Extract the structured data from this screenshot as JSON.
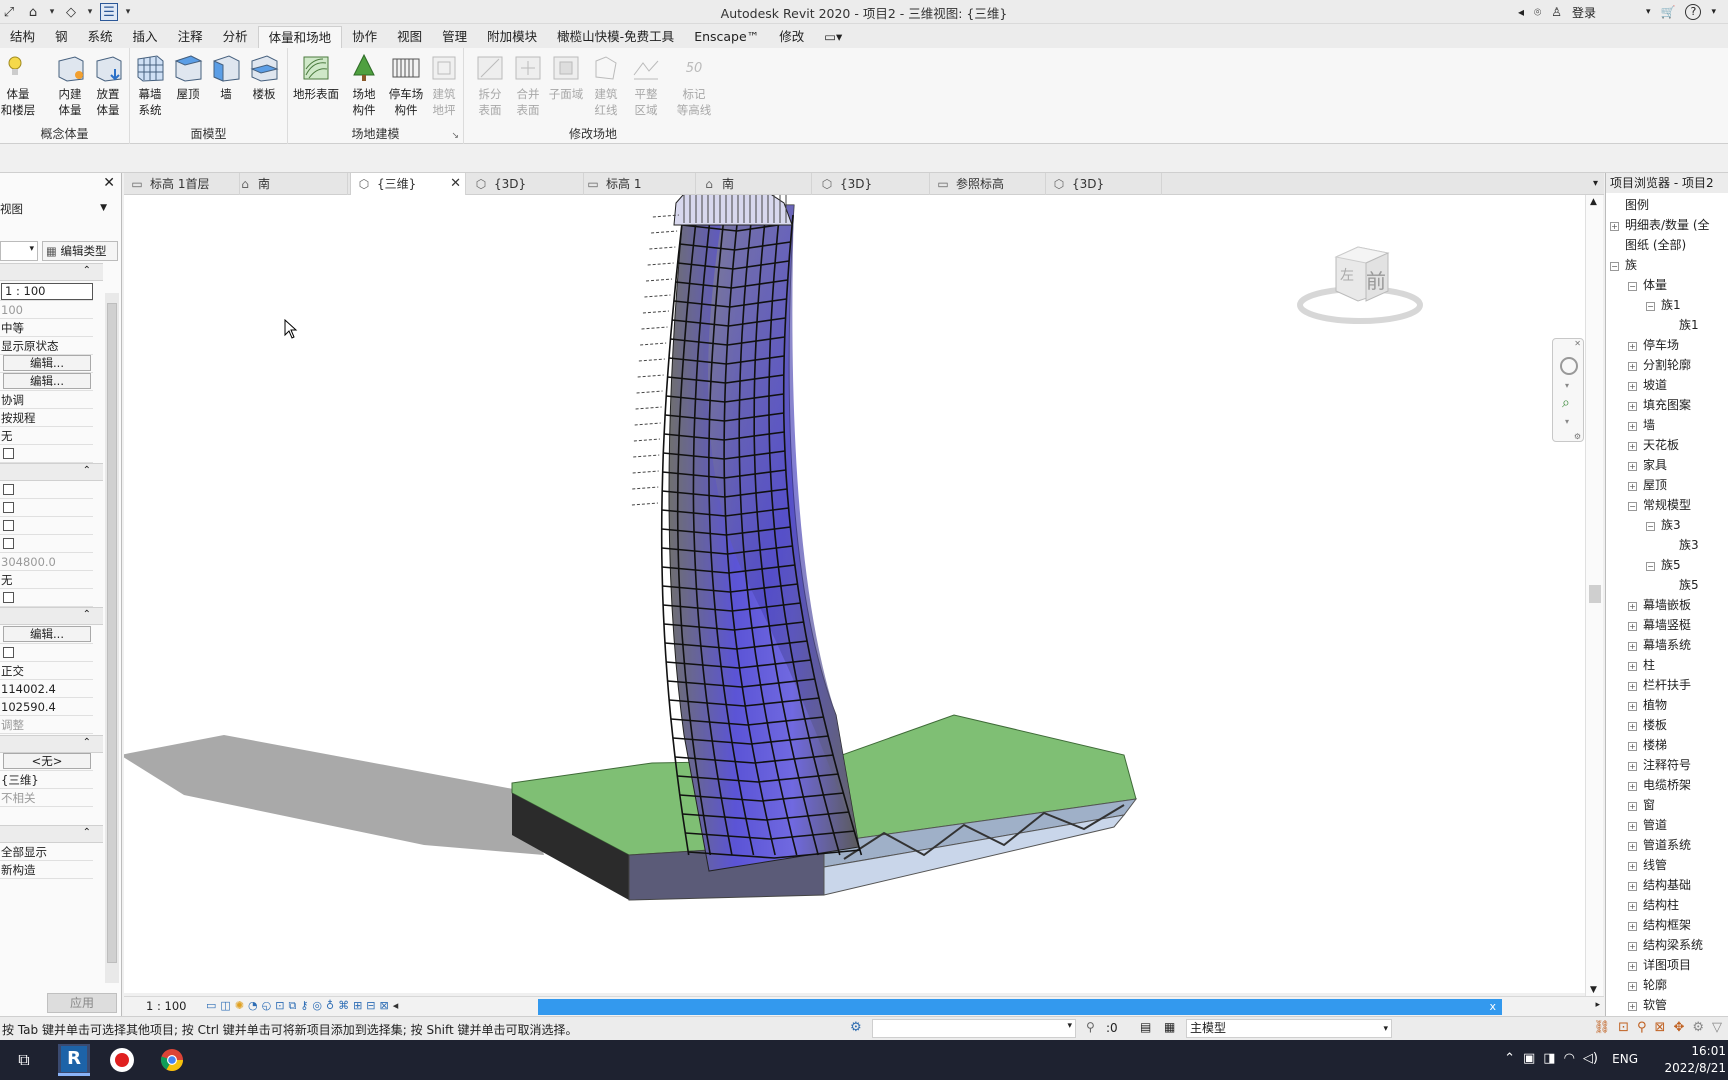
{
  "window": {
    "title": "Autodesk Revit 2020 - 项目2 - 三维视图: {三维}",
    "signin": "登录"
  },
  "menu_tabs": [
    "结构",
    "钢",
    "系统",
    "插入",
    "注释",
    "分析",
    "体量和场地",
    "协作",
    "视图",
    "管理",
    "附加模块",
    "橄榄山快模-免费工具",
    "Enscape™",
    "修改"
  ],
  "active_menu_tab": "体量和场地",
  "ribbon": {
    "groups": [
      {
        "label": "概念体量",
        "buttons": [
          "体量\n和楼层",
          "内建\n体量",
          "放置\n体量"
        ]
      },
      {
        "label": "面模型",
        "buttons": [
          "幕墙\n系统",
          "屋顶",
          "墙",
          "楼板"
        ]
      },
      {
        "label": "场地建模",
        "buttons": [
          "地形表面",
          "场地\n构件",
          "停车场\n构件",
          "建筑\n地坪"
        ]
      },
      {
        "label": "修改场地",
        "buttons": [
          "拆分\n表面",
          "合并\n表面",
          "子面域",
          "建筑\n红线",
          "平整\n区域",
          "标记\n等高线"
        ]
      }
    ]
  },
  "properties": {
    "type_label": "视图",
    "edit_type": "编辑类型",
    "rows": [
      "1 : 100",
      "100",
      "中等",
      "显示原状态",
      "编辑...",
      "编辑...",
      "协调",
      "按规程",
      "无",
      "",
      "",
      "",
      "",
      "",
      "304800.0",
      "无",
      "",
      "编辑...",
      "",
      "正交",
      "114002.4",
      "102590.4",
      "调整",
      "<无>",
      "{三维}",
      "不相关",
      "全部显示",
      "新构造"
    ],
    "apply": "应用"
  },
  "view_tabs": [
    {
      "label": "标高 1首层",
      "icon": "floor-plan-icon"
    },
    {
      "label": "南",
      "icon": "elevation-icon"
    },
    {
      "label": "{三维}",
      "icon": "3d-view-icon",
      "active": true
    },
    {
      "label": "{3D}",
      "icon": "3d-view-icon"
    },
    {
      "label": "标高 1",
      "icon": "floor-plan-icon"
    },
    {
      "label": "南",
      "icon": "elevation-icon"
    },
    {
      "label": "{3D}",
      "icon": "3d-view-icon"
    },
    {
      "label": "参照标高",
      "icon": "floor-plan-icon"
    },
    {
      "label": "{3D}",
      "icon": "3d-view-icon"
    }
  ],
  "viewcube": {
    "front": "前",
    "left": "左"
  },
  "view_scale": "1 : 100",
  "browser": {
    "title": "项目浏览器 - 项目2",
    "items": [
      {
        "label": "图例",
        "level": 0,
        "toggle": ""
      },
      {
        "label": "明细表/数量 (全",
        "level": 0,
        "toggle": "+"
      },
      {
        "label": "图纸 (全部)",
        "level": 0,
        "toggle": ""
      },
      {
        "label": "族",
        "level": 0,
        "toggle": "-"
      },
      {
        "label": "体量",
        "level": 1,
        "toggle": "-"
      },
      {
        "label": "族1",
        "level": 2,
        "toggle": "-"
      },
      {
        "label": "族1",
        "level": 3,
        "toggle": ""
      },
      {
        "label": "停车场",
        "level": 1,
        "toggle": "+"
      },
      {
        "label": "分割轮廓",
        "level": 1,
        "toggle": "+"
      },
      {
        "label": "坡道",
        "level": 1,
        "toggle": "+"
      },
      {
        "label": "填充图案",
        "level": 1,
        "toggle": "+"
      },
      {
        "label": "墙",
        "level": 1,
        "toggle": "+"
      },
      {
        "label": "天花板",
        "level": 1,
        "toggle": "+"
      },
      {
        "label": "家具",
        "level": 1,
        "toggle": "+"
      },
      {
        "label": "屋顶",
        "level": 1,
        "toggle": "+"
      },
      {
        "label": "常规模型",
        "level": 1,
        "toggle": "-"
      },
      {
        "label": "族3",
        "level": 2,
        "toggle": "-"
      },
      {
        "label": "族3",
        "level": 3,
        "toggle": ""
      },
      {
        "label": "族5",
        "level": 2,
        "toggle": "-"
      },
      {
        "label": "族5",
        "level": 3,
        "toggle": ""
      },
      {
        "label": "幕墙嵌板",
        "level": 1,
        "toggle": "+"
      },
      {
        "label": "幕墙竖梃",
        "level": 1,
        "toggle": "+"
      },
      {
        "label": "幕墙系统",
        "level": 1,
        "toggle": "+"
      },
      {
        "label": "柱",
        "level": 1,
        "toggle": "+"
      },
      {
        "label": "栏杆扶手",
        "level": 1,
        "toggle": "+"
      },
      {
        "label": "植物",
        "level": 1,
        "toggle": "+"
      },
      {
        "label": "楼板",
        "level": 1,
        "toggle": "+"
      },
      {
        "label": "楼梯",
        "level": 1,
        "toggle": "+"
      },
      {
        "label": "注释符号",
        "level": 1,
        "toggle": "+"
      },
      {
        "label": "电缆桥架",
        "level": 1,
        "toggle": "+"
      },
      {
        "label": "窗",
        "level": 1,
        "toggle": "+"
      },
      {
        "label": "管道",
        "level": 1,
        "toggle": "+"
      },
      {
        "label": "管道系统",
        "level": 1,
        "toggle": "+"
      },
      {
        "label": "线管",
        "level": 1,
        "toggle": "+"
      },
      {
        "label": "结构基础",
        "level": 1,
        "toggle": "+"
      },
      {
        "label": "结构柱",
        "level": 1,
        "toggle": "+"
      },
      {
        "label": "结构框架",
        "level": 1,
        "toggle": "+"
      },
      {
        "label": "结构梁系统",
        "level": 1,
        "toggle": "+"
      },
      {
        "label": "详图项目",
        "level": 1,
        "toggle": "+"
      },
      {
        "label": "轮廓",
        "level": 1,
        "toggle": "+"
      },
      {
        "label": "软管",
        "level": 1,
        "toggle": "+"
      }
    ]
  },
  "status": {
    "message": "按 Tab 键并单击可选择其他项目; 按 Ctrl 键并单击可将新项目添加到选择集; 按 Shift 键并单击可取消选择。",
    "selection_count": ":0",
    "model": "主模型"
  },
  "taskbar": {
    "lang": "ENG",
    "time": "16:01",
    "date": "2022/8/21"
  },
  "colors": {
    "accent": "#3399ee",
    "glass": "#5b54d6",
    "roof_green": "#7fbf74"
  }
}
